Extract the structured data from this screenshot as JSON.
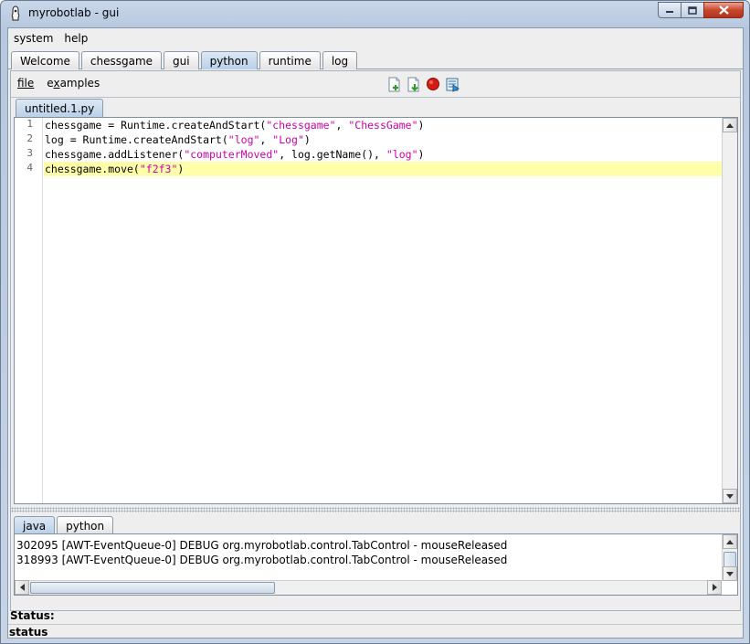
{
  "window": {
    "title": "myrobotlab - gui",
    "buttons": [
      "minimize",
      "maximize",
      "close"
    ]
  },
  "menubar": {
    "items": [
      "system",
      "help"
    ]
  },
  "tabs": {
    "items": [
      "Welcome",
      "chessgame",
      "gui",
      "python",
      "runtime",
      "log"
    ],
    "selected": "python"
  },
  "python": {
    "menu": {
      "file": "file",
      "examples_prefix": "e",
      "examples_underlined": "x",
      "examples_suffix": "amples"
    },
    "toolbar": {
      "icons": [
        "new-file-icon",
        "save-file-icon",
        "stop-icon",
        "execute-icon"
      ]
    },
    "file_tab": "untitled.1.py",
    "line_numbers": [
      "1",
      "2",
      "3",
      "4"
    ],
    "code": [
      {
        "parts": [
          {
            "t": "chessgame = Runtime.createAndStart(",
            "c": ""
          },
          {
            "t": "\"chessgame\"",
            "c": "str"
          },
          {
            "t": ", ",
            "c": ""
          },
          {
            "t": "\"ChessGame\"",
            "c": "str"
          },
          {
            "t": ")",
            "c": ""
          }
        ]
      },
      {
        "parts": [
          {
            "t": "log = Runtime.createAndStart(",
            "c": ""
          },
          {
            "t": "\"log\"",
            "c": "str"
          },
          {
            "t": ", ",
            "c": ""
          },
          {
            "t": "\"Log\"",
            "c": "str"
          },
          {
            "t": ")",
            "c": ""
          }
        ]
      },
      {
        "parts": [
          {
            "t": "chessgame.addListener(",
            "c": ""
          },
          {
            "t": "\"computerMoved\"",
            "c": "str"
          },
          {
            "t": ", log.getName(), ",
            "c": ""
          },
          {
            "t": "\"log\"",
            "c": "str"
          },
          {
            "t": ")",
            "c": ""
          }
        ]
      },
      {
        "parts": [
          {
            "t": "chessgame.move(",
            "c": ""
          },
          {
            "t": "\"f2f3\"",
            "c": "str"
          },
          {
            "t": ")",
            "c": ""
          }
        ],
        "highlighted": true
      }
    ]
  },
  "bottom_tabs": {
    "items": [
      "java",
      "python"
    ],
    "selected": "java"
  },
  "log": {
    "lines": [
      "302095 [AWT-EventQueue-0] DEBUG org.myrobotlab.control.TabControl  - mouseReleased",
      "318993 [AWT-EventQueue-0] DEBUG org.myrobotlab.control.TabControl  - mouseReleased"
    ]
  },
  "status": {
    "panel_label": "Status:",
    "bar_text": "status"
  },
  "colors": {
    "string_literal": "#cc00aa",
    "current_line": "#ffffaa",
    "selected_tab": "#b8cfe8"
  }
}
